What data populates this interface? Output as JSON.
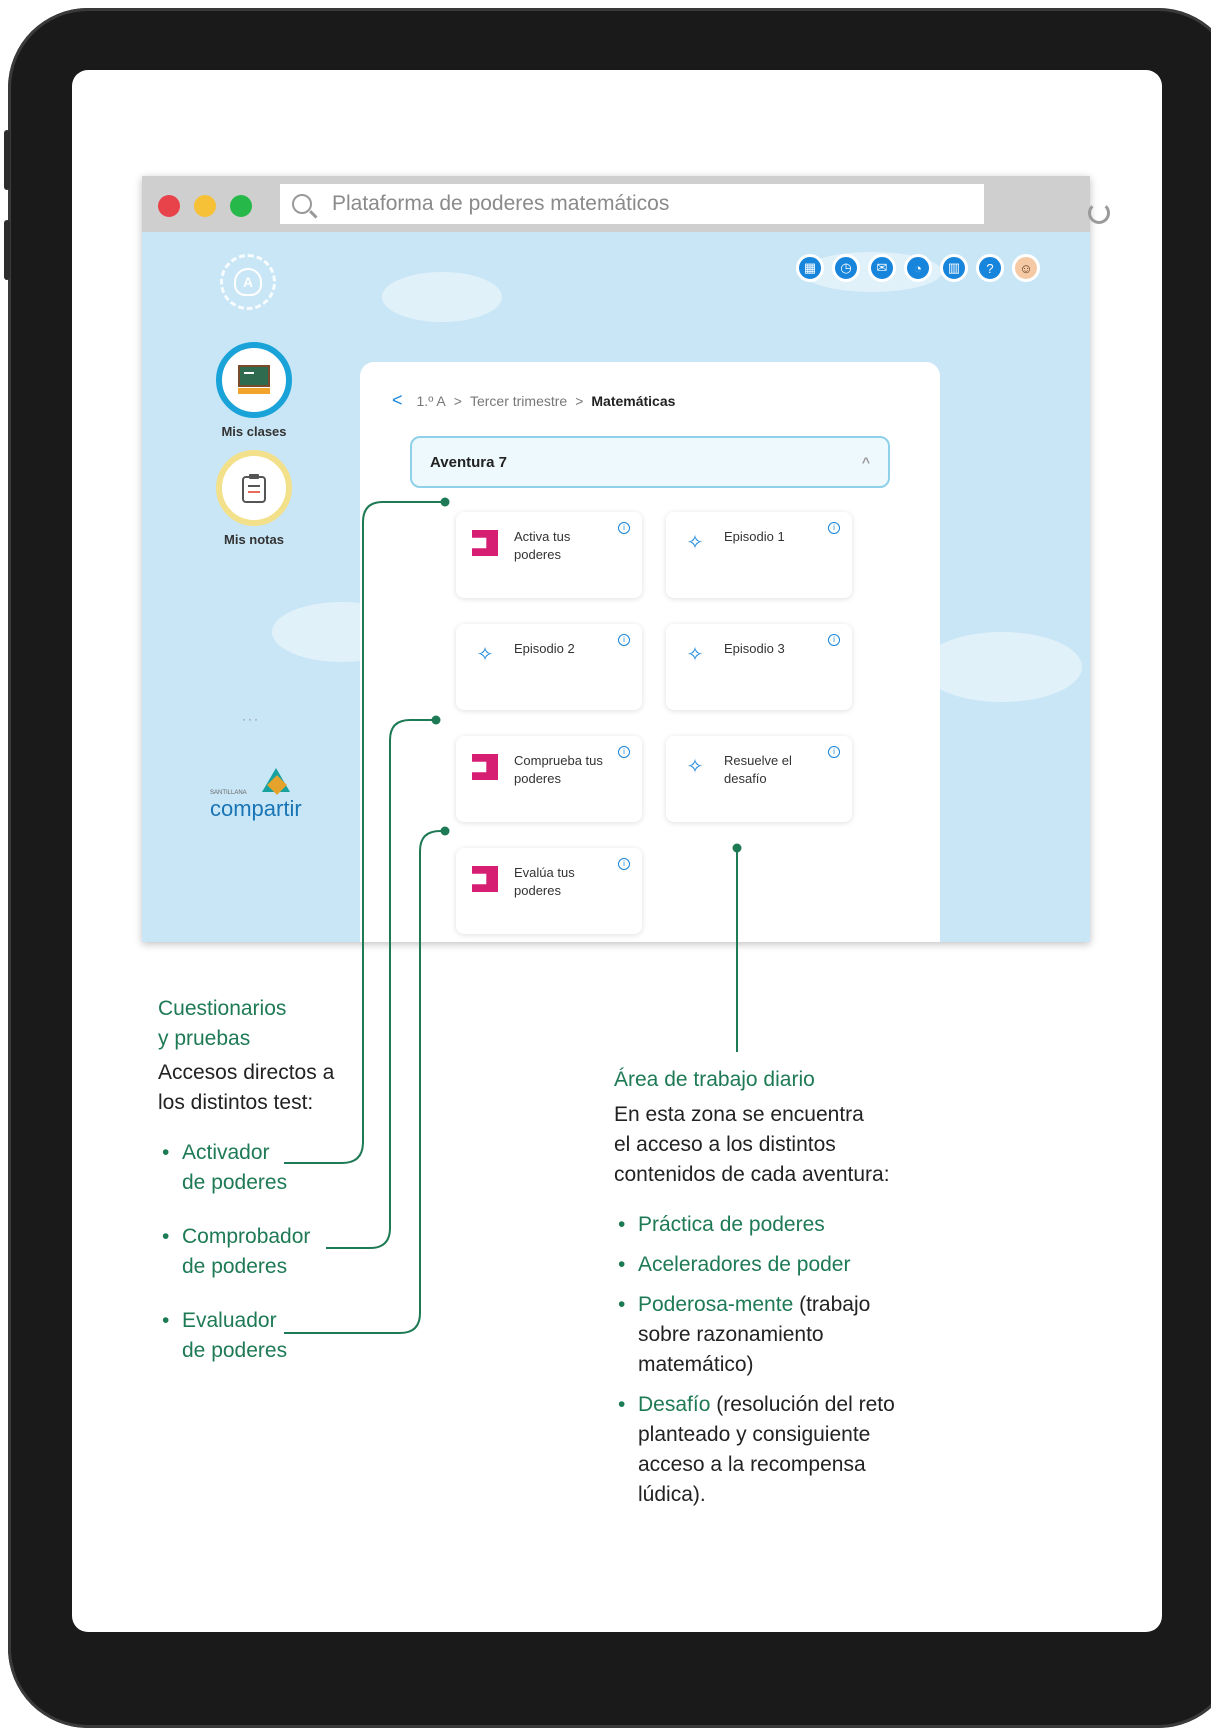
{
  "browser": {
    "url_text": "Plataforma de poderes matemáticos",
    "traffic_lights": [
      "#e8424b",
      "#f6c137",
      "#27b84a"
    ]
  },
  "sidebar": {
    "items": [
      {
        "label": "Mis clases",
        "icon": "classroom-icon"
      },
      {
        "label": "Mis notas",
        "icon": "clipboard-icon"
      }
    ],
    "ellipsis": "···",
    "partner_brand": "SANTILLANA",
    "partner_logo": "compartir"
  },
  "toolbar": {
    "icons": [
      "calendar-icon",
      "clock-icon",
      "mail-icon",
      "bell-icon",
      "chart-icon",
      "help-icon",
      "avatar-icon"
    ]
  },
  "breadcrumb": {
    "back": "<",
    "items": [
      "1.º A",
      "Tercer trimestre"
    ],
    "separator": ">",
    "current": "Matemáticas"
  },
  "adventure_select": {
    "value": "Aventura 7",
    "chevron": "^"
  },
  "cards": [
    {
      "label": "Activa tus poderes",
      "icon": "test-icon"
    },
    {
      "label": "Episodio 1",
      "icon": "sparkle-icon"
    },
    {
      "label": "Episodio 2",
      "icon": "sparkle-icon"
    },
    {
      "label": "Episodio 3",
      "icon": "sparkle-icon"
    },
    {
      "label": "Comprueba tus poderes",
      "icon": "test-icon"
    },
    {
      "label": "Resuelve el desafío",
      "icon": "sparkle-icon"
    },
    {
      "label": "Evalúa tus poderes",
      "icon": "test-icon"
    }
  ],
  "annotation_left": {
    "title_line1": "Cuestionarios",
    "title_line2": "y pruebas",
    "body_line1": "Accesos directos a",
    "body_line2": "los distintos test:",
    "items": [
      {
        "line1": "Activador",
        "line2": "de poderes"
      },
      {
        "line1": "Comprobador",
        "line2": "de poderes"
      },
      {
        "line1": "Evaluador",
        "line2": "de poderes"
      }
    ]
  },
  "annotation_right": {
    "title": "Área de trabajo diario",
    "body_line1": "En esta zona se encuentra",
    "body_line2": "el acceso a los distintos",
    "body_line3": "contenidos de cada aventura:",
    "items": [
      {
        "green": "Práctica de poderes",
        "rest": ""
      },
      {
        "green": "Aceleradores de poder",
        "rest": ""
      },
      {
        "green": "Poderosa-mente",
        "rest": " (trabajo sobre razonamiento matemático)"
      },
      {
        "green": "Desafío",
        "rest": " (resolución del reto planteado y consiguiente acceso a la recompensa lúdica)."
      }
    ]
  },
  "colors": {
    "accent_green": "#1e7a55",
    "accent_blue": "#1785dc",
    "test_pink": "#d61f72",
    "sky": "#c9e6f6"
  }
}
